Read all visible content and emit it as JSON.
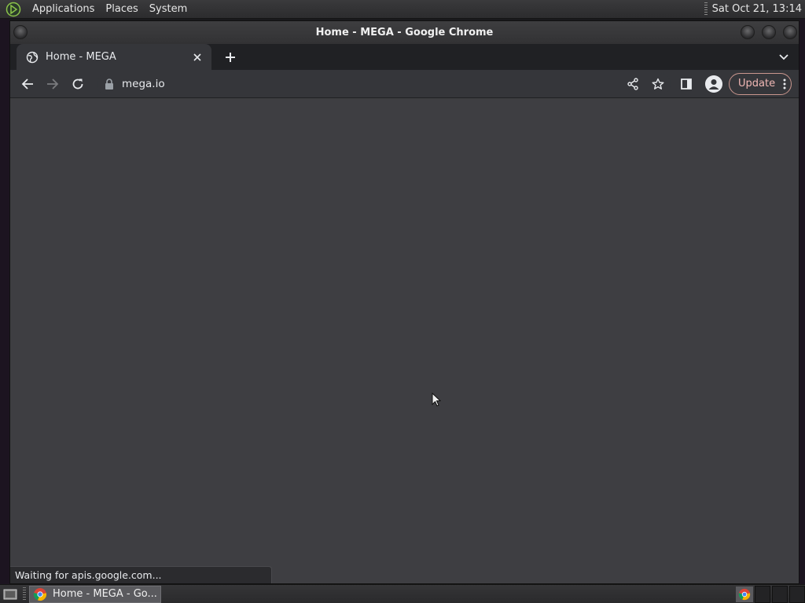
{
  "top_panel": {
    "menus": [
      "Applications",
      "Places",
      "System"
    ],
    "clock": "Sat Oct 21, 13:14"
  },
  "window": {
    "title": "Home - MEGA - Google Chrome"
  },
  "tabs": [
    {
      "title": "Home - MEGA",
      "favicon": "globe-icon"
    }
  ],
  "toolbar": {
    "url": "mega.io",
    "update_label": "Update"
  },
  "status": {
    "text": "Waiting for apis.google.com..."
  },
  "taskbar": {
    "task_label": "Home - MEGA - Go..."
  },
  "colors": {
    "content_bg": "#3e3e42",
    "toolbar_bg": "#35363a",
    "tabstrip_bg": "#202124",
    "update_border": "#c9968e"
  }
}
